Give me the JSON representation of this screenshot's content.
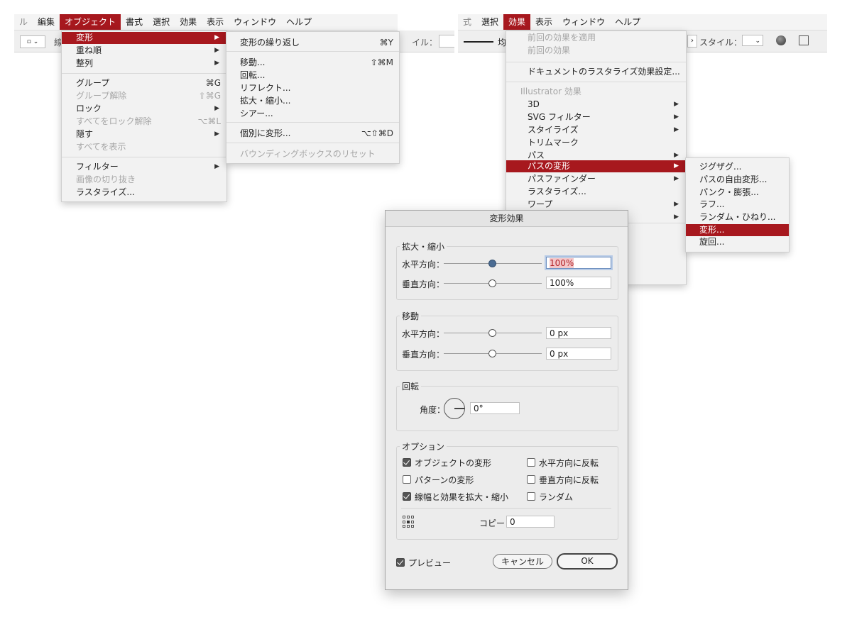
{
  "left_menubar": {
    "items": [
      {
        "label": "ル",
        "state": "dim"
      },
      {
        "label": "編集"
      },
      {
        "label": "オブジェクト",
        "state": "selected"
      },
      {
        "label": "書式"
      },
      {
        "label": "選択"
      },
      {
        "label": "効果"
      },
      {
        "label": "表示"
      },
      {
        "label": "ウィンドウ"
      },
      {
        "label": "ヘルプ"
      }
    ],
    "toolbar_text": "イル：",
    "toolbar_prefix": "線"
  },
  "object_menu": [
    {
      "label": "変形",
      "arrow": "▶",
      "highlight": true
    },
    {
      "label": "重ね順",
      "arrow": "▶"
    },
    {
      "label": "整列",
      "arrow": "▶"
    },
    {
      "label": "グループ",
      "shortcut": "⌘G"
    },
    {
      "label": "グループ解除",
      "shortcut": "⇧⌘G",
      "disabled": true
    },
    {
      "label": "ロック",
      "arrow": "▶"
    },
    {
      "label": "すべてをロック解除",
      "shortcut": "⌥⌘L",
      "disabled": true
    },
    {
      "label": "隠す",
      "arrow": "▶"
    },
    {
      "label": "すべてを表示",
      "disabled": true
    },
    {
      "label": "フィルター",
      "arrow": "▶"
    },
    {
      "label": "画像の切り抜き",
      "disabled": true
    },
    {
      "label": "ラスタライズ..."
    }
  ],
  "transform_submenu": [
    {
      "label": "変形の繰り返し",
      "shortcut": "⌘Y"
    },
    {
      "label": "移動...",
      "shortcut": "⇧⌘M"
    },
    {
      "label": "回転..."
    },
    {
      "label": "リフレクト..."
    },
    {
      "label": "拡大・縮小..."
    },
    {
      "label": "シアー..."
    },
    {
      "label": "個別に変形...",
      "shortcut": "⌥⇧⌘D"
    },
    {
      "label": "バウンディングボックスのリセット",
      "disabled": true
    }
  ],
  "right_menubar": {
    "items": [
      {
        "label": "式",
        "state": "dim"
      },
      {
        "label": "選択"
      },
      {
        "label": "効果",
        "state": "selected"
      },
      {
        "label": "表示"
      },
      {
        "label": "ウィンドウ"
      },
      {
        "label": "ヘルプ"
      }
    ],
    "toolbar_style_label": "スタイル：",
    "toolbar_prefix": "均"
  },
  "effect_menu": [
    {
      "label": "前回の効果を適用",
      "disabled": true
    },
    {
      "label": "前回の効果",
      "disabled": true
    },
    {
      "label": "ドキュメントのラスタライズ効果設定..."
    },
    {
      "label": "Illustrator 効果",
      "header": true
    },
    {
      "label": "3D",
      "arrow": "▶"
    },
    {
      "label": "SVG フィルター",
      "arrow": "▶"
    },
    {
      "label": "スタイライズ",
      "arrow": "▶"
    },
    {
      "label": "トリムマーク"
    },
    {
      "label": "パス",
      "arrow": "▶"
    },
    {
      "label": "パスの変形",
      "arrow": "▶",
      "highlight": true
    },
    {
      "label": "パスファインダー",
      "arrow": "▶"
    },
    {
      "label": "ラスタライズ..."
    },
    {
      "label": "ワープ",
      "arrow": "▶"
    },
    {
      "label": "",
      "arrow": "▶"
    }
  ],
  "distort_submenu": [
    {
      "label": "ジグザグ..."
    },
    {
      "label": "パスの自由変形..."
    },
    {
      "label": "パンク・膨張..."
    },
    {
      "label": "ラフ..."
    },
    {
      "label": "ランダム・ひねり..."
    },
    {
      "label": "変形...",
      "highlight": true
    },
    {
      "label": "旋回..."
    }
  ],
  "dialog": {
    "title": "変形効果",
    "scale": {
      "title": "拡大・縮小",
      "horizontal_label": "水平方向：",
      "horizontal_value": "100%",
      "vertical_label": "垂直方向：",
      "vertical_value": "100%"
    },
    "move": {
      "title": "移動",
      "horizontal_label": "水平方向：",
      "horizontal_value": "0 px",
      "vertical_label": "垂直方向：",
      "vertical_value": "0 px"
    },
    "rotate": {
      "title": "回転",
      "angle_label": "角度：",
      "angle_value": "0°"
    },
    "options": {
      "title": "オプション",
      "transform_objects": "オブジェクトの変形",
      "transform_objects_checked": true,
      "transform_patterns": "パターンの変形",
      "transform_patterns_checked": false,
      "scale_strokes": "線幅と効果を拡大・縮小",
      "scale_strokes_checked": true,
      "reflect_x": "水平方向に反転",
      "reflect_x_checked": false,
      "reflect_y": "垂直方向に反転",
      "reflect_y_checked": false,
      "random": "ランダム",
      "random_checked": false,
      "copies_label": "コピー",
      "copies_value": "0"
    },
    "preview_label": "プレビュー",
    "preview_checked": true,
    "cancel_label": "キャンセル",
    "ok_label": "OK"
  }
}
